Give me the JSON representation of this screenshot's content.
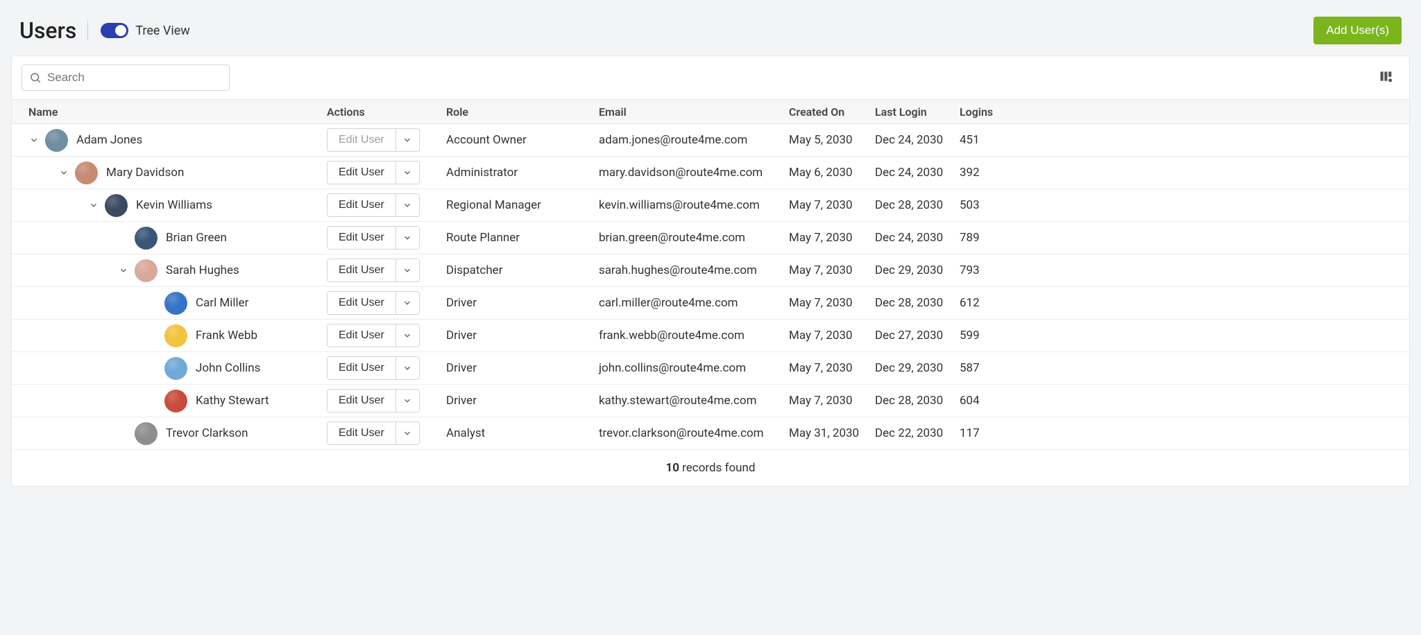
{
  "header": {
    "title": "Users",
    "tree_view_label": "Tree View",
    "add_button": "Add User(s)"
  },
  "toolbar": {
    "search_placeholder": "Search"
  },
  "columns": {
    "name": "Name",
    "actions": "Actions",
    "role": "Role",
    "email": "Email",
    "created_on": "Created On",
    "last_login": "Last Login",
    "logins": "Logins"
  },
  "edit_label": "Edit User",
  "users": [
    {
      "indent": 0,
      "expandable": true,
      "editable": false,
      "name": "Adam Jones",
      "role": "Account Owner",
      "email": "adam.jones@route4me.com",
      "created_on": "May 5, 2030",
      "last_login": "Dec 24, 2030",
      "logins": "451",
      "avatar": "#6f8ea2"
    },
    {
      "indent": 1,
      "expandable": true,
      "editable": true,
      "name": "Mary Davidson",
      "role": "Administrator",
      "email": "mary.davidson@route4me.com",
      "created_on": "May 6, 2030",
      "last_login": "Dec 24, 2030",
      "logins": "392",
      "avatar": "#c78a72"
    },
    {
      "indent": 2,
      "expandable": true,
      "editable": true,
      "name": "Kevin Williams",
      "role": "Regional Manager",
      "email": "kevin.williams@route4me.com",
      "created_on": "May 7, 2030",
      "last_login": "Dec 28, 2030",
      "logins": "503",
      "avatar": "#3a4a5f"
    },
    {
      "indent": 3,
      "expandable": false,
      "editable": true,
      "name": "Brian Green",
      "role": "Route Planner",
      "email": "brian.green@route4me.com",
      "created_on": "May 7, 2030",
      "last_login": "Dec 24, 2030",
      "logins": "789",
      "avatar": "#3b5578"
    },
    {
      "indent": 3,
      "expandable": true,
      "editable": true,
      "name": "Sarah Hughes",
      "role": "Dispatcher",
      "email": "sarah.hughes@route4me.com",
      "created_on": "May 7, 2030",
      "last_login": "Dec 29, 2030",
      "logins": "793",
      "avatar": "#d9a89a"
    },
    {
      "indent": 4,
      "expandable": false,
      "editable": true,
      "name": "Carl Miller",
      "role": "Driver",
      "email": "carl.miller@route4me.com",
      "created_on": "May 7, 2030",
      "last_login": "Dec 28, 2030",
      "logins": "612",
      "avatar": "#3573c6"
    },
    {
      "indent": 4,
      "expandable": false,
      "editable": true,
      "name": "Frank Webb",
      "role": "Driver",
      "email": "frank.webb@route4me.com",
      "created_on": "May 7, 2030",
      "last_login": "Dec 27, 2030",
      "logins": "599",
      "avatar": "#f2c33c"
    },
    {
      "indent": 4,
      "expandable": false,
      "editable": true,
      "name": "John Collins",
      "role": "Driver",
      "email": "john.collins@route4me.com",
      "created_on": "May 7, 2030",
      "last_login": "Dec 29, 2030",
      "logins": "587",
      "avatar": "#6ea9d8"
    },
    {
      "indent": 4,
      "expandable": false,
      "editable": true,
      "name": "Kathy Stewart",
      "role": "Driver",
      "email": "kathy.stewart@route4me.com",
      "created_on": "May 7, 2030",
      "last_login": "Dec 28, 2030",
      "logins": "604",
      "avatar": "#c94b3b"
    },
    {
      "indent": 3,
      "expandable": false,
      "editable": true,
      "name": "Trevor Clarkson",
      "role": "Analyst",
      "email": "trevor.clarkson@route4me.com",
      "created_on": "May 31, 2030",
      "last_login": "Dec 22, 2030",
      "logins": "117",
      "avatar": "#8e8e8e"
    }
  ],
  "footer": {
    "count": "10",
    "label": " records found"
  }
}
